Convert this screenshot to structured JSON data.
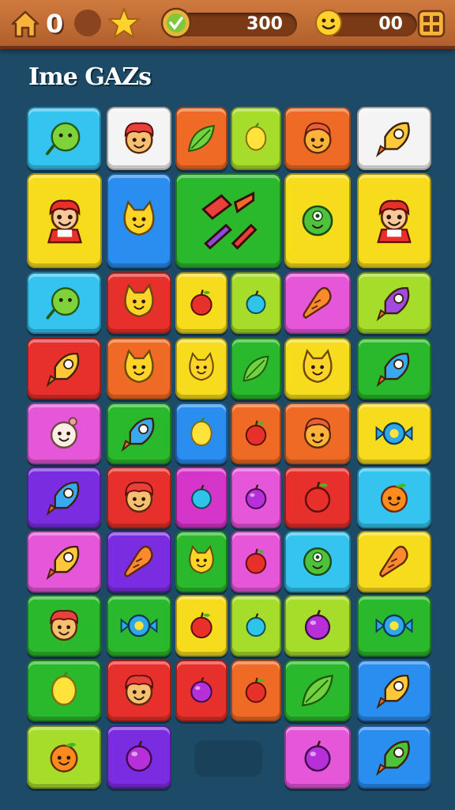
{
  "hud": {
    "lives": "0",
    "score": "300",
    "coins": "00"
  },
  "title": "Ime GAZs",
  "colors": {
    "cyan": "#34c4ef",
    "white": "#f4f4f4",
    "orange": "#ef6b25",
    "lime": "#a6dc2a",
    "yellow": "#f6dc1c",
    "blue": "#2a8df0",
    "green": "#2ab82c",
    "red": "#e7302b",
    "pink": "#e556d9",
    "purple": "#7a2de0",
    "magenta": "#d536c9"
  },
  "board": {
    "rows": [
      [
        {
          "color": "cyan",
          "icon": "lime-fruit-icon"
        },
        {
          "color": "white",
          "icon": "red-creature-icon"
        },
        {
          "color": "orange",
          "icon": "leaf-icon"
        },
        {
          "color": "lime",
          "icon": "lemon-icon"
        },
        {
          "color": "orange",
          "icon": "orange-creature-icon"
        },
        {
          "color": "white",
          "icon": "rocket-icon"
        }
      ],
      [
        {
          "color": "yellow",
          "icon": "red-hero-icon",
          "big": true
        },
        {
          "color": "blue",
          "icon": "yellow-cat-icon",
          "big": true
        },
        {
          "color": "green",
          "icon": "tools-pack-icon",
          "big": true,
          "wide": true
        },
        {
          "color": "yellow",
          "icon": "green-monster-icon",
          "big": true
        },
        {
          "color": "yellow",
          "icon": "red-hero-icon",
          "big": true
        }
      ],
      [
        {
          "color": "cyan",
          "icon": "lime-fruit-icon"
        },
        {
          "color": "red",
          "icon": "yellow-cat-icon"
        },
        {
          "color": "yellow",
          "icon": "apple-icon"
        },
        {
          "color": "lime",
          "icon": "cyan-berry-icon"
        },
        {
          "color": "pink",
          "icon": "carrot-icon"
        },
        {
          "color": "lime",
          "icon": "purple-rocket-icon"
        }
      ],
      [
        {
          "color": "red",
          "icon": "rocket-icon"
        },
        {
          "color": "orange",
          "icon": "yellow-cat-icon"
        },
        {
          "color": "yellow",
          "icon": "yellow-cat-icon"
        },
        {
          "color": "green",
          "icon": "leaf-icon"
        },
        {
          "color": "yellow",
          "icon": "yellow-cat-icon"
        },
        {
          "color": "green",
          "icon": "blue-rocket-icon"
        }
      ],
      [
        {
          "color": "pink",
          "icon": "white-bun-icon"
        },
        {
          "color": "green",
          "icon": "blue-rocket-icon"
        },
        {
          "color": "blue",
          "icon": "lemon-icon"
        },
        {
          "color": "orange",
          "icon": "apple-icon"
        },
        {
          "color": "orange",
          "icon": "orange-creature-icon"
        },
        {
          "color": "yellow",
          "icon": "candy-icon"
        }
      ],
      [
        {
          "color": "purple",
          "icon": "blue-rocket-icon"
        },
        {
          "color": "red",
          "icon": "red-creature-icon"
        },
        {
          "color": "magenta",
          "icon": "cyan-berry-icon"
        },
        {
          "color": "pink",
          "icon": "purple-berry-icon"
        },
        {
          "color": "red",
          "icon": "apple-icon"
        },
        {
          "color": "cyan",
          "icon": "orange-fruit-icon"
        }
      ],
      [
        {
          "color": "pink",
          "icon": "rocket-icon"
        },
        {
          "color": "purple",
          "icon": "carrot-icon"
        },
        {
          "color": "green",
          "icon": "yellow-cat-icon"
        },
        {
          "color": "pink",
          "icon": "apple-icon"
        },
        {
          "color": "cyan",
          "icon": "green-monster-icon"
        },
        {
          "color": "yellow",
          "icon": "carrot-icon"
        }
      ],
      [
        {
          "color": "green",
          "icon": "red-creature-icon"
        },
        {
          "color": "green",
          "icon": "candy-icon"
        },
        {
          "color": "yellow",
          "icon": "apple-icon"
        },
        {
          "color": "lime",
          "icon": "cyan-berry-icon"
        },
        {
          "color": "lime",
          "icon": "purple-berry-icon"
        },
        {
          "color": "green",
          "icon": "candy-icon"
        }
      ],
      [
        {
          "color": "green",
          "icon": "lemon-icon"
        },
        {
          "color": "red",
          "icon": "red-creature-icon"
        },
        {
          "color": "red",
          "icon": "purple-berry-icon"
        },
        {
          "color": "orange",
          "icon": "apple-icon"
        },
        {
          "color": "green",
          "icon": "leaf-icon"
        },
        {
          "color": "blue",
          "icon": "rocket-icon"
        }
      ],
      [
        {
          "color": "lime",
          "icon": "orange-fruit-icon"
        },
        {
          "color": "purple",
          "icon": "purple-berry-icon"
        },
        null,
        null,
        {
          "color": "pink",
          "icon": "purple-berry-icon"
        },
        {
          "color": "blue",
          "icon": "green-rocket-icon"
        }
      ]
    ]
  }
}
